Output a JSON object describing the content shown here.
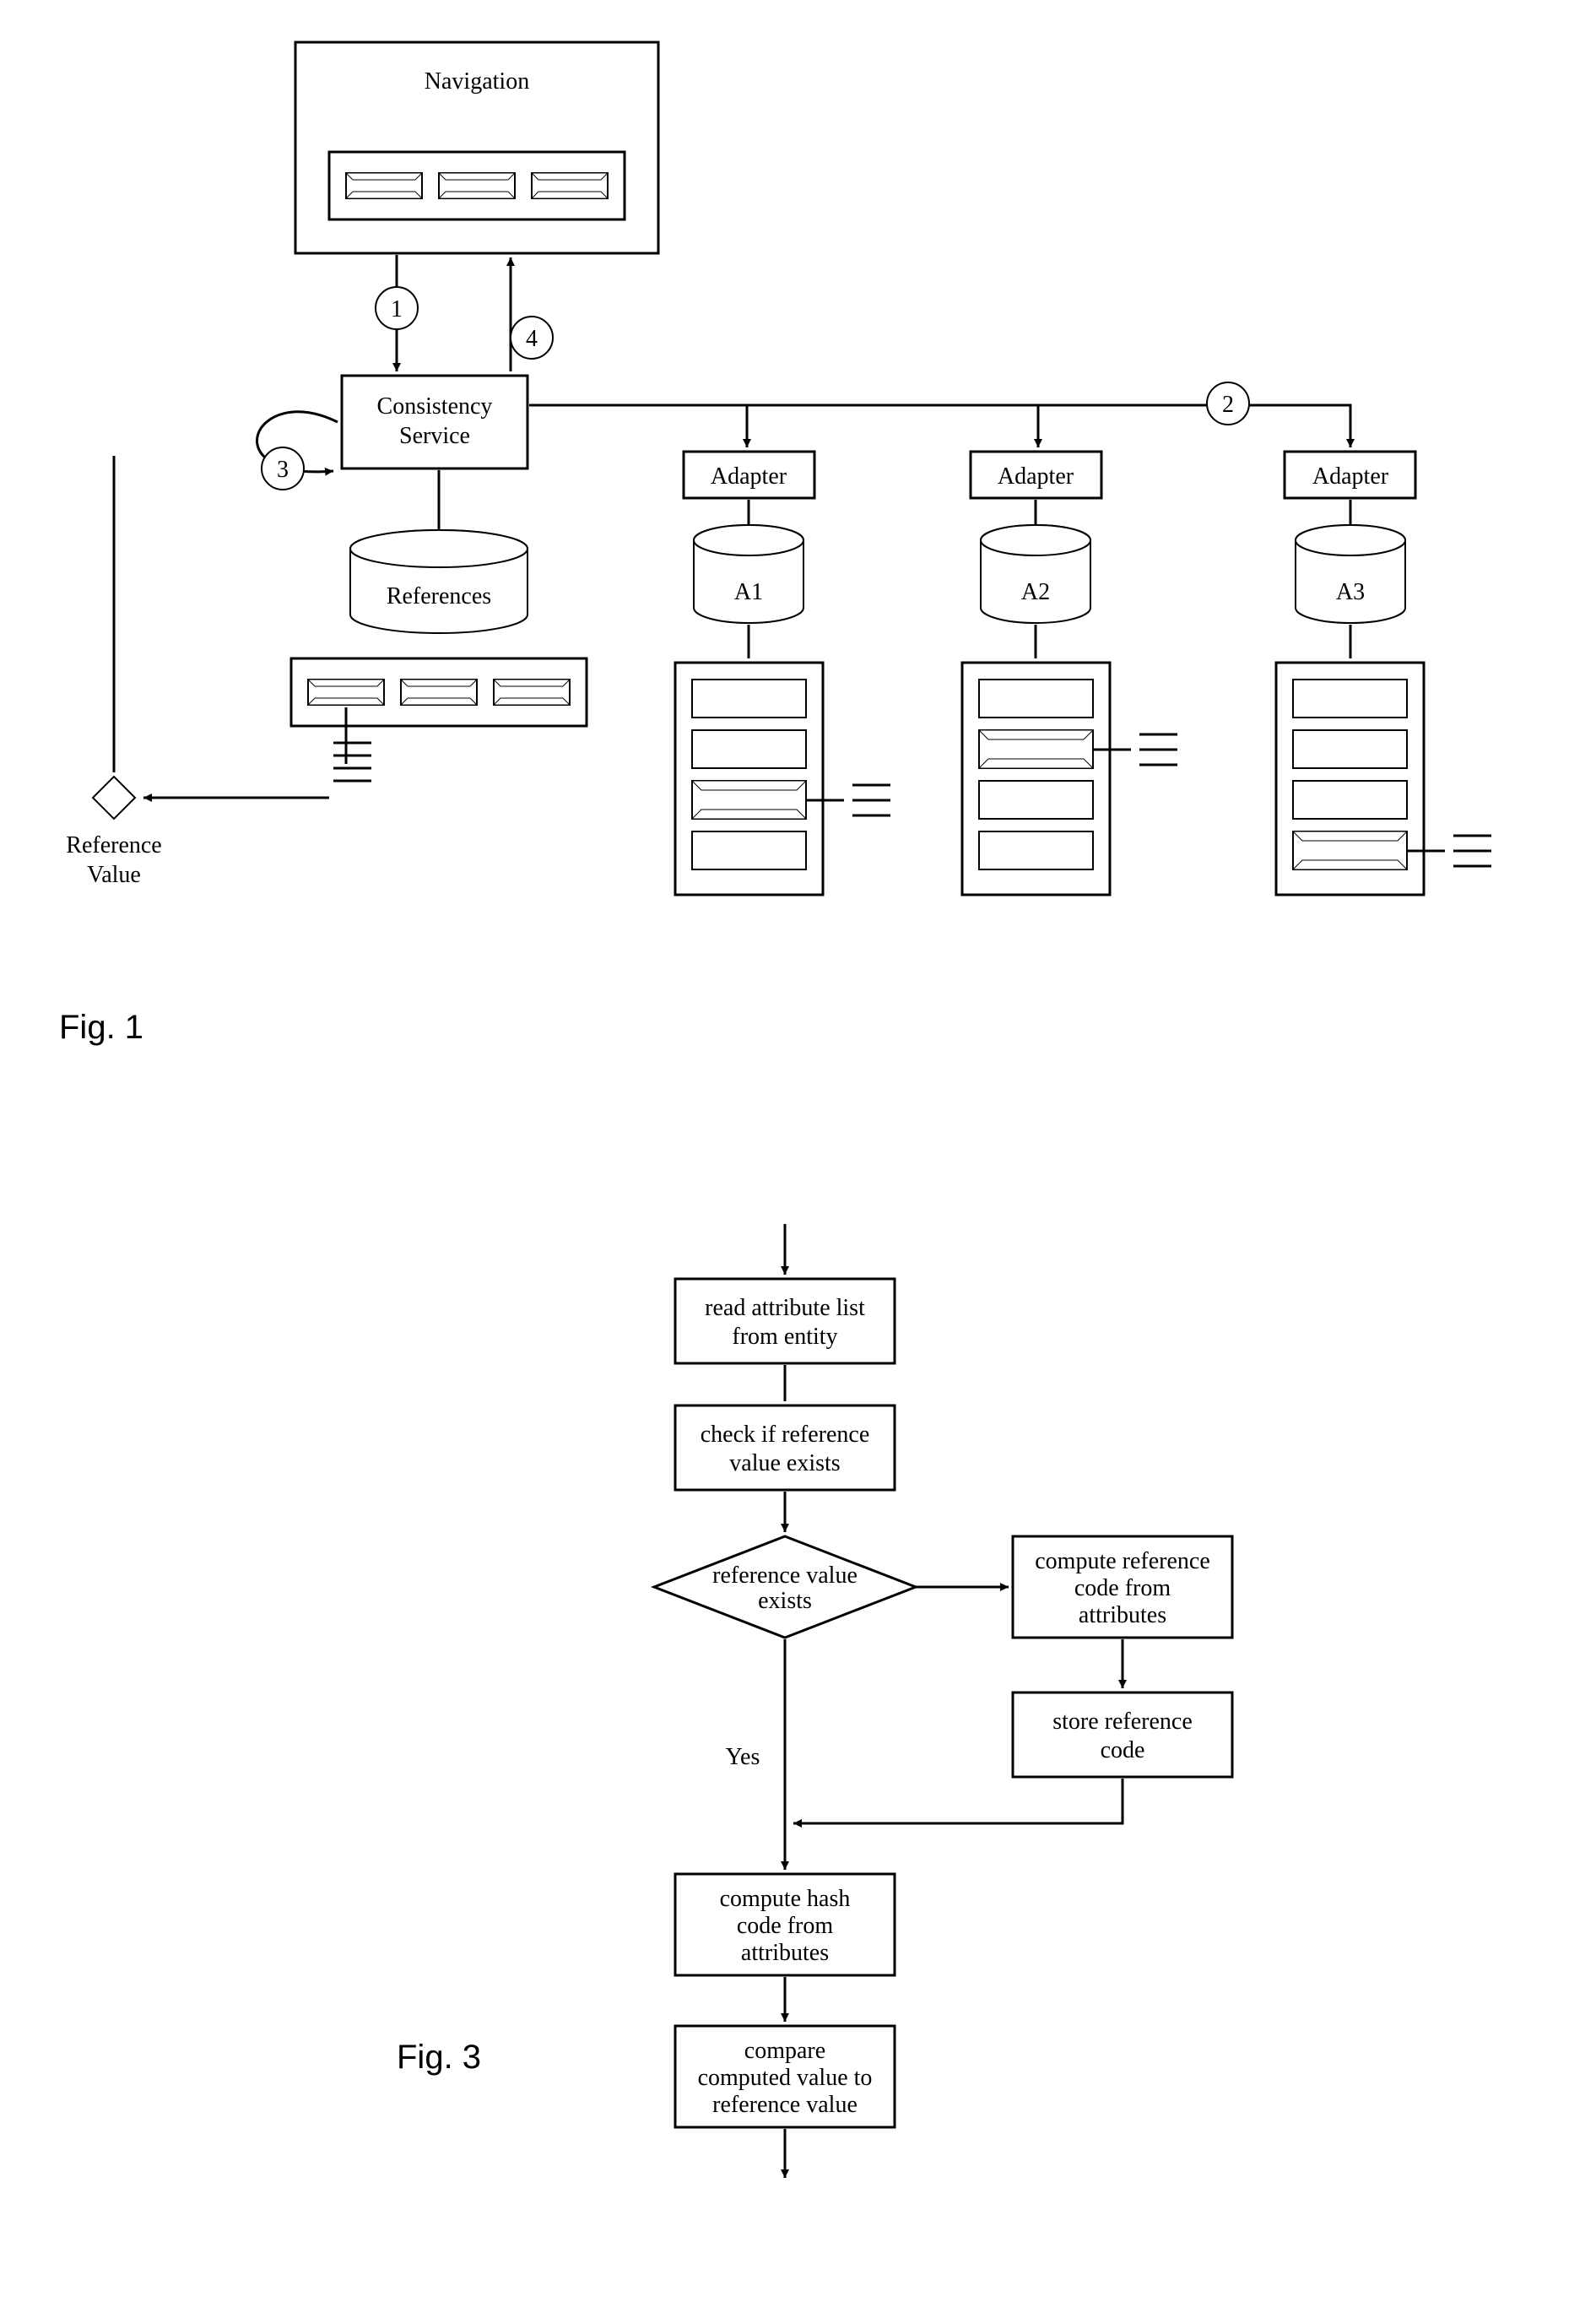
{
  "fig1": {
    "caption": "Fig. 1",
    "nav": "Navigation",
    "cs_line1": "Consistency",
    "cs_line2": "Service",
    "refs": "References",
    "refval_line1": "Reference",
    "refval_line2": "Value",
    "adapters": [
      "Adapter",
      "Adapter",
      "Adapter"
    ],
    "adapter_ids": [
      "A1",
      "A2",
      "A3"
    ],
    "step_labels": [
      "1",
      "2",
      "3",
      "4"
    ]
  },
  "fig3": {
    "caption": "Fig.  3",
    "steps": {
      "s1_l1": "read attribute list",
      "s1_l2": "from entity",
      "s2_l1": "check if reference",
      "s2_l2": "value exists",
      "dec_l1": "reference value",
      "dec_l2": "exists",
      "yes": "Yes",
      "s3_l1": "compute reference",
      "s3_l2": "code from",
      "s3_l3": "attributes",
      "s4_l1": "store reference",
      "s4_l2": "code",
      "s5_l1": "compute hash",
      "s5_l2": "code from",
      "s5_l3": "attributes",
      "s6_l1": "compare",
      "s6_l2": "computed value to",
      "s6_l3": "reference value"
    }
  }
}
